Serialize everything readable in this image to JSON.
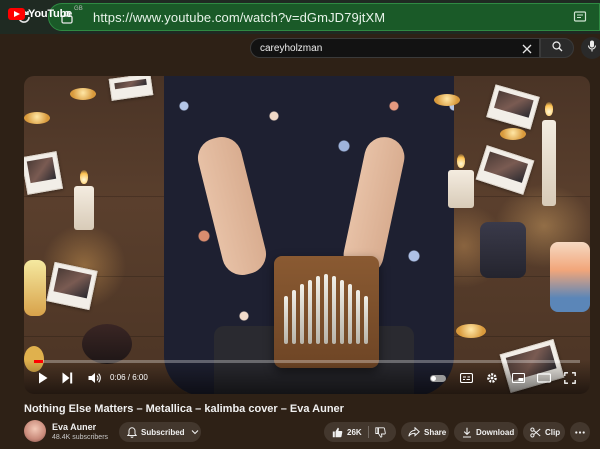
{
  "browser": {
    "url": "https://www.youtube.com/watch?v=dGmJD79jtXM"
  },
  "header": {
    "logo_text": "YouTube",
    "country_code": "GB",
    "search_value": "careyholzman"
  },
  "player": {
    "time_display": "0:06 / 6:00",
    "progress_fraction": 0.0167,
    "autoplay_on": false
  },
  "video": {
    "title": "Nothing Else Matters – Metallica – kalimba cover – Eva Auner"
  },
  "channel": {
    "name": "Eva Auner",
    "subscribers": "48.4K subscribers",
    "subscribe_label": "Subscribed"
  },
  "actions": {
    "like_count": "26K",
    "share_label": "Share",
    "download_label": "Download",
    "clip_label": "Clip"
  },
  "colors": {
    "accent": "#ff0000",
    "url_bar": "#1a5a28"
  }
}
